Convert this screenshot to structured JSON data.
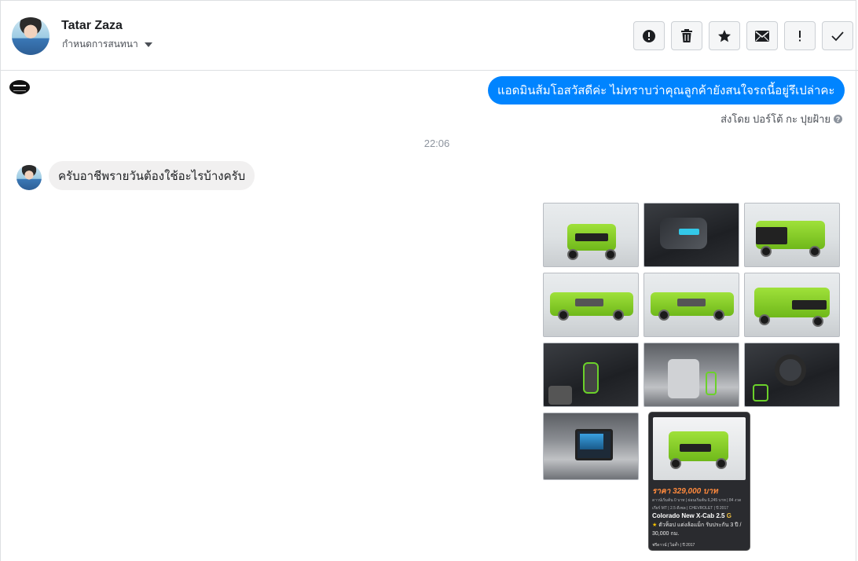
{
  "header": {
    "contact_name": "Tatar Zaza",
    "contact_subtitle": "กำหนดการสนทนา",
    "actions": [
      {
        "name": "report",
        "icon": "alert-circle-icon"
      },
      {
        "name": "delete",
        "icon": "trash-icon"
      },
      {
        "name": "star",
        "icon": "star-icon"
      },
      {
        "name": "mark-unread",
        "icon": "envelope-icon"
      },
      {
        "name": "important",
        "icon": "exclamation-icon"
      },
      {
        "name": "done",
        "icon": "check-icon"
      }
    ]
  },
  "messages": {
    "sent_text": "แอดมินส้มโอสวัสดีค่ะ ไม่ทราบว่าคุณลูกค้ายังสนใจรถนี้อยู่รึเปล่าคะ",
    "sent_by": "ส่งโดย ปอร์โต้ กะ ปุยฝ้าย",
    "timestamp": "22:06",
    "received_text": "ครับอาชีพรายวันต้องใช้อะไรบ้างครับ"
  },
  "attachments": {
    "photo_count_shown": 11,
    "ad_card": {
      "price": "ราคา 329,000 บาท",
      "spec_line1": "ดาวน์เริ่มต้น 0 บาท | ผ่อนเริ่มต้น 6,245 บาท | 84 งวด",
      "spec_line2": "เกียร์ MT | 2.5 ดีเซล | CHEVROLET | ปี 2017",
      "model": "Colorado New X-Cab 2.5",
      "model_suffix": "G",
      "feature": "ตัวท็อป แต่งล้อแม็ก รับประกัน 3 ปี / 30,000 กม.",
      "footer": "ฟรีดาวน์ | ไม่ค้ำ | ปี 2017"
    }
  },
  "colors": {
    "accent": "#0084ff",
    "received_bubble": "#f1f0f0",
    "divider": "#dddfe2"
  }
}
